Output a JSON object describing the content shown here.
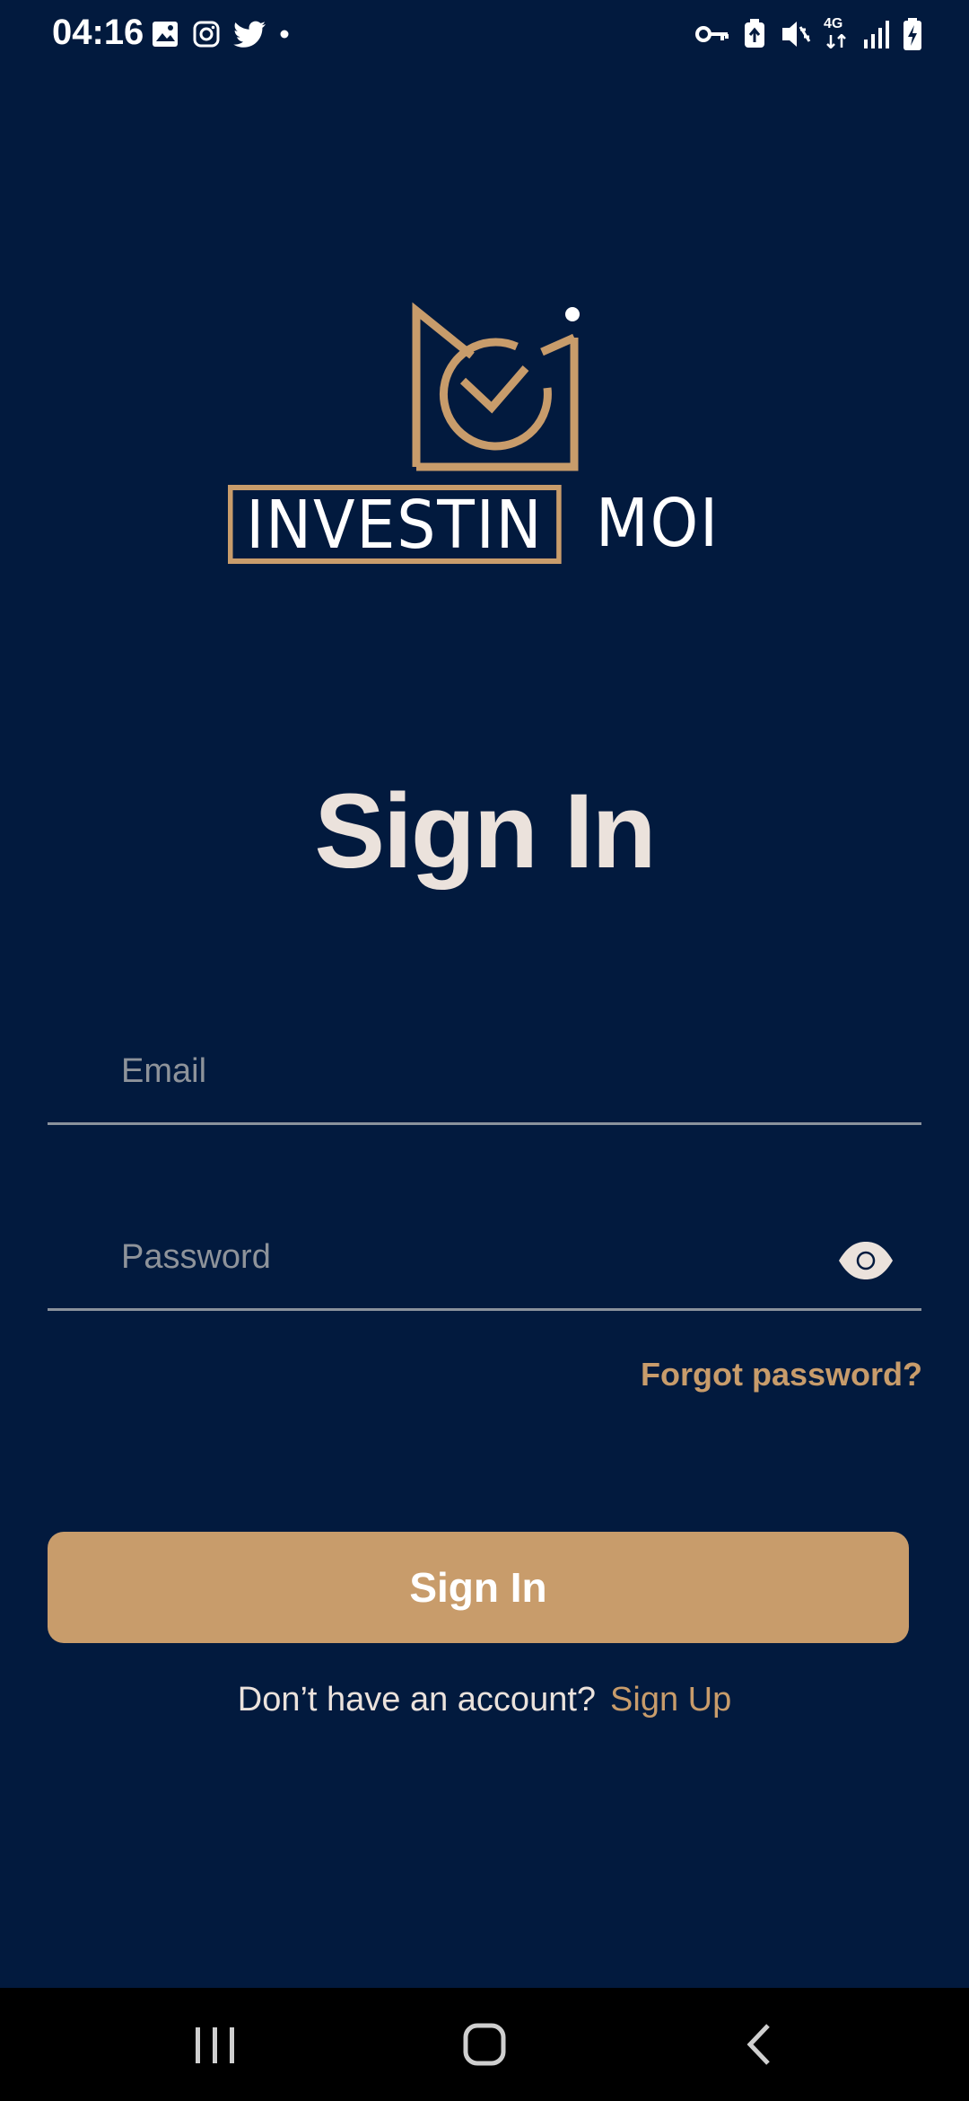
{
  "status_bar": {
    "time": "04:16",
    "left_icons": [
      "gallery-icon",
      "instagram-icon",
      "twitter-icon",
      "dot-icon"
    ],
    "right_icons": [
      "vpn-key-icon",
      "data-saver-icon",
      "vibrate-icon",
      "network-4g-icon",
      "signal-icon",
      "battery-charging-icon"
    ],
    "network_label": "4G"
  },
  "logo": {
    "boxed_word": "INVESTIN",
    "plain_word": "MOI",
    "accent_color": "#c89c6b"
  },
  "page": {
    "title": "Sign In"
  },
  "form": {
    "email_placeholder": "Email",
    "email_value": "",
    "password_placeholder": "Password",
    "password_value": "",
    "forgot_password": "Forgot password?",
    "submit_label": "Sign In"
  },
  "signup": {
    "prompt": "Don’t have an account?",
    "link": "Sign Up"
  },
  "nav_bar": {
    "buttons": [
      "recents-icon",
      "home-icon",
      "back-icon"
    ]
  },
  "colors": {
    "background": "#021a3e",
    "accent": "#c89c6b",
    "title_text": "#ebe2dc"
  }
}
